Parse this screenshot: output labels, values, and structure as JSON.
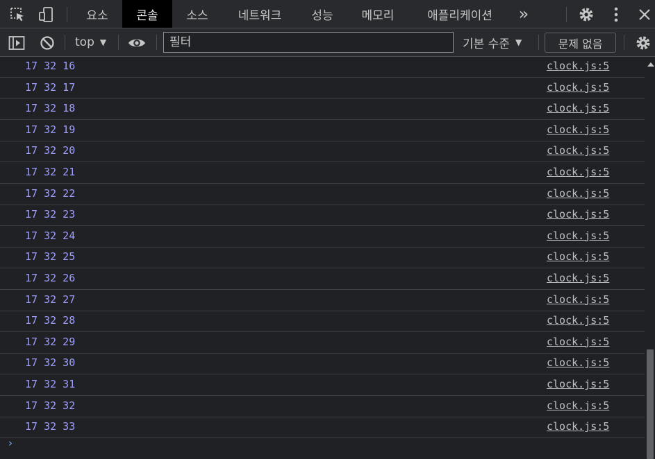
{
  "tabs": {
    "items": [
      {
        "label": "요소"
      },
      {
        "label": "콘솔"
      },
      {
        "label": "소스"
      },
      {
        "label": "네트워크"
      },
      {
        "label": "성능"
      },
      {
        "label": "메모리"
      },
      {
        "label": "애플리케이션"
      }
    ],
    "active": "콘솔",
    "overflow_glyph": "»"
  },
  "toolbar": {
    "context_label": "top",
    "filter_placeholder": "필터",
    "levels_label": "기본 수준",
    "issues_label": "문제 없음"
  },
  "console": {
    "messages": [
      {
        "text": "17 32 16",
        "source": "clock.js:5"
      },
      {
        "text": "17 32 17",
        "source": "clock.js:5"
      },
      {
        "text": "17 32 18",
        "source": "clock.js:5"
      },
      {
        "text": "17 32 19",
        "source": "clock.js:5"
      },
      {
        "text": "17 32 20",
        "source": "clock.js:5"
      },
      {
        "text": "17 32 21",
        "source": "clock.js:5"
      },
      {
        "text": "17 32 22",
        "source": "clock.js:5"
      },
      {
        "text": "17 32 23",
        "source": "clock.js:5"
      },
      {
        "text": "17 32 24",
        "source": "clock.js:5"
      },
      {
        "text": "17 32 25",
        "source": "clock.js:5"
      },
      {
        "text": "17 32 26",
        "source": "clock.js:5"
      },
      {
        "text": "17 32 27",
        "source": "clock.js:5"
      },
      {
        "text": "17 32 28",
        "source": "clock.js:5"
      },
      {
        "text": "17 32 29",
        "source": "clock.js:5"
      },
      {
        "text": "17 32 30",
        "source": "clock.js:5"
      },
      {
        "text": "17 32 31",
        "source": "clock.js:5"
      },
      {
        "text": "17 32 32",
        "source": "clock.js:5"
      },
      {
        "text": "17 32 33",
        "source": "clock.js:5"
      }
    ],
    "prompt_glyph": "›"
  },
  "colors": {
    "background": "#202124",
    "toolbar": "#292a2d",
    "active_tab": "#000000",
    "message_text": "#9e9eff",
    "prompt": "#7cacf8"
  },
  "icons": [
    "inspect-element-icon",
    "device-toolbar-icon",
    "settings-gear-icon",
    "kebab-menu-icon",
    "close-icon",
    "sidebar-toggle-icon",
    "clear-console-icon",
    "eye-icon"
  ]
}
